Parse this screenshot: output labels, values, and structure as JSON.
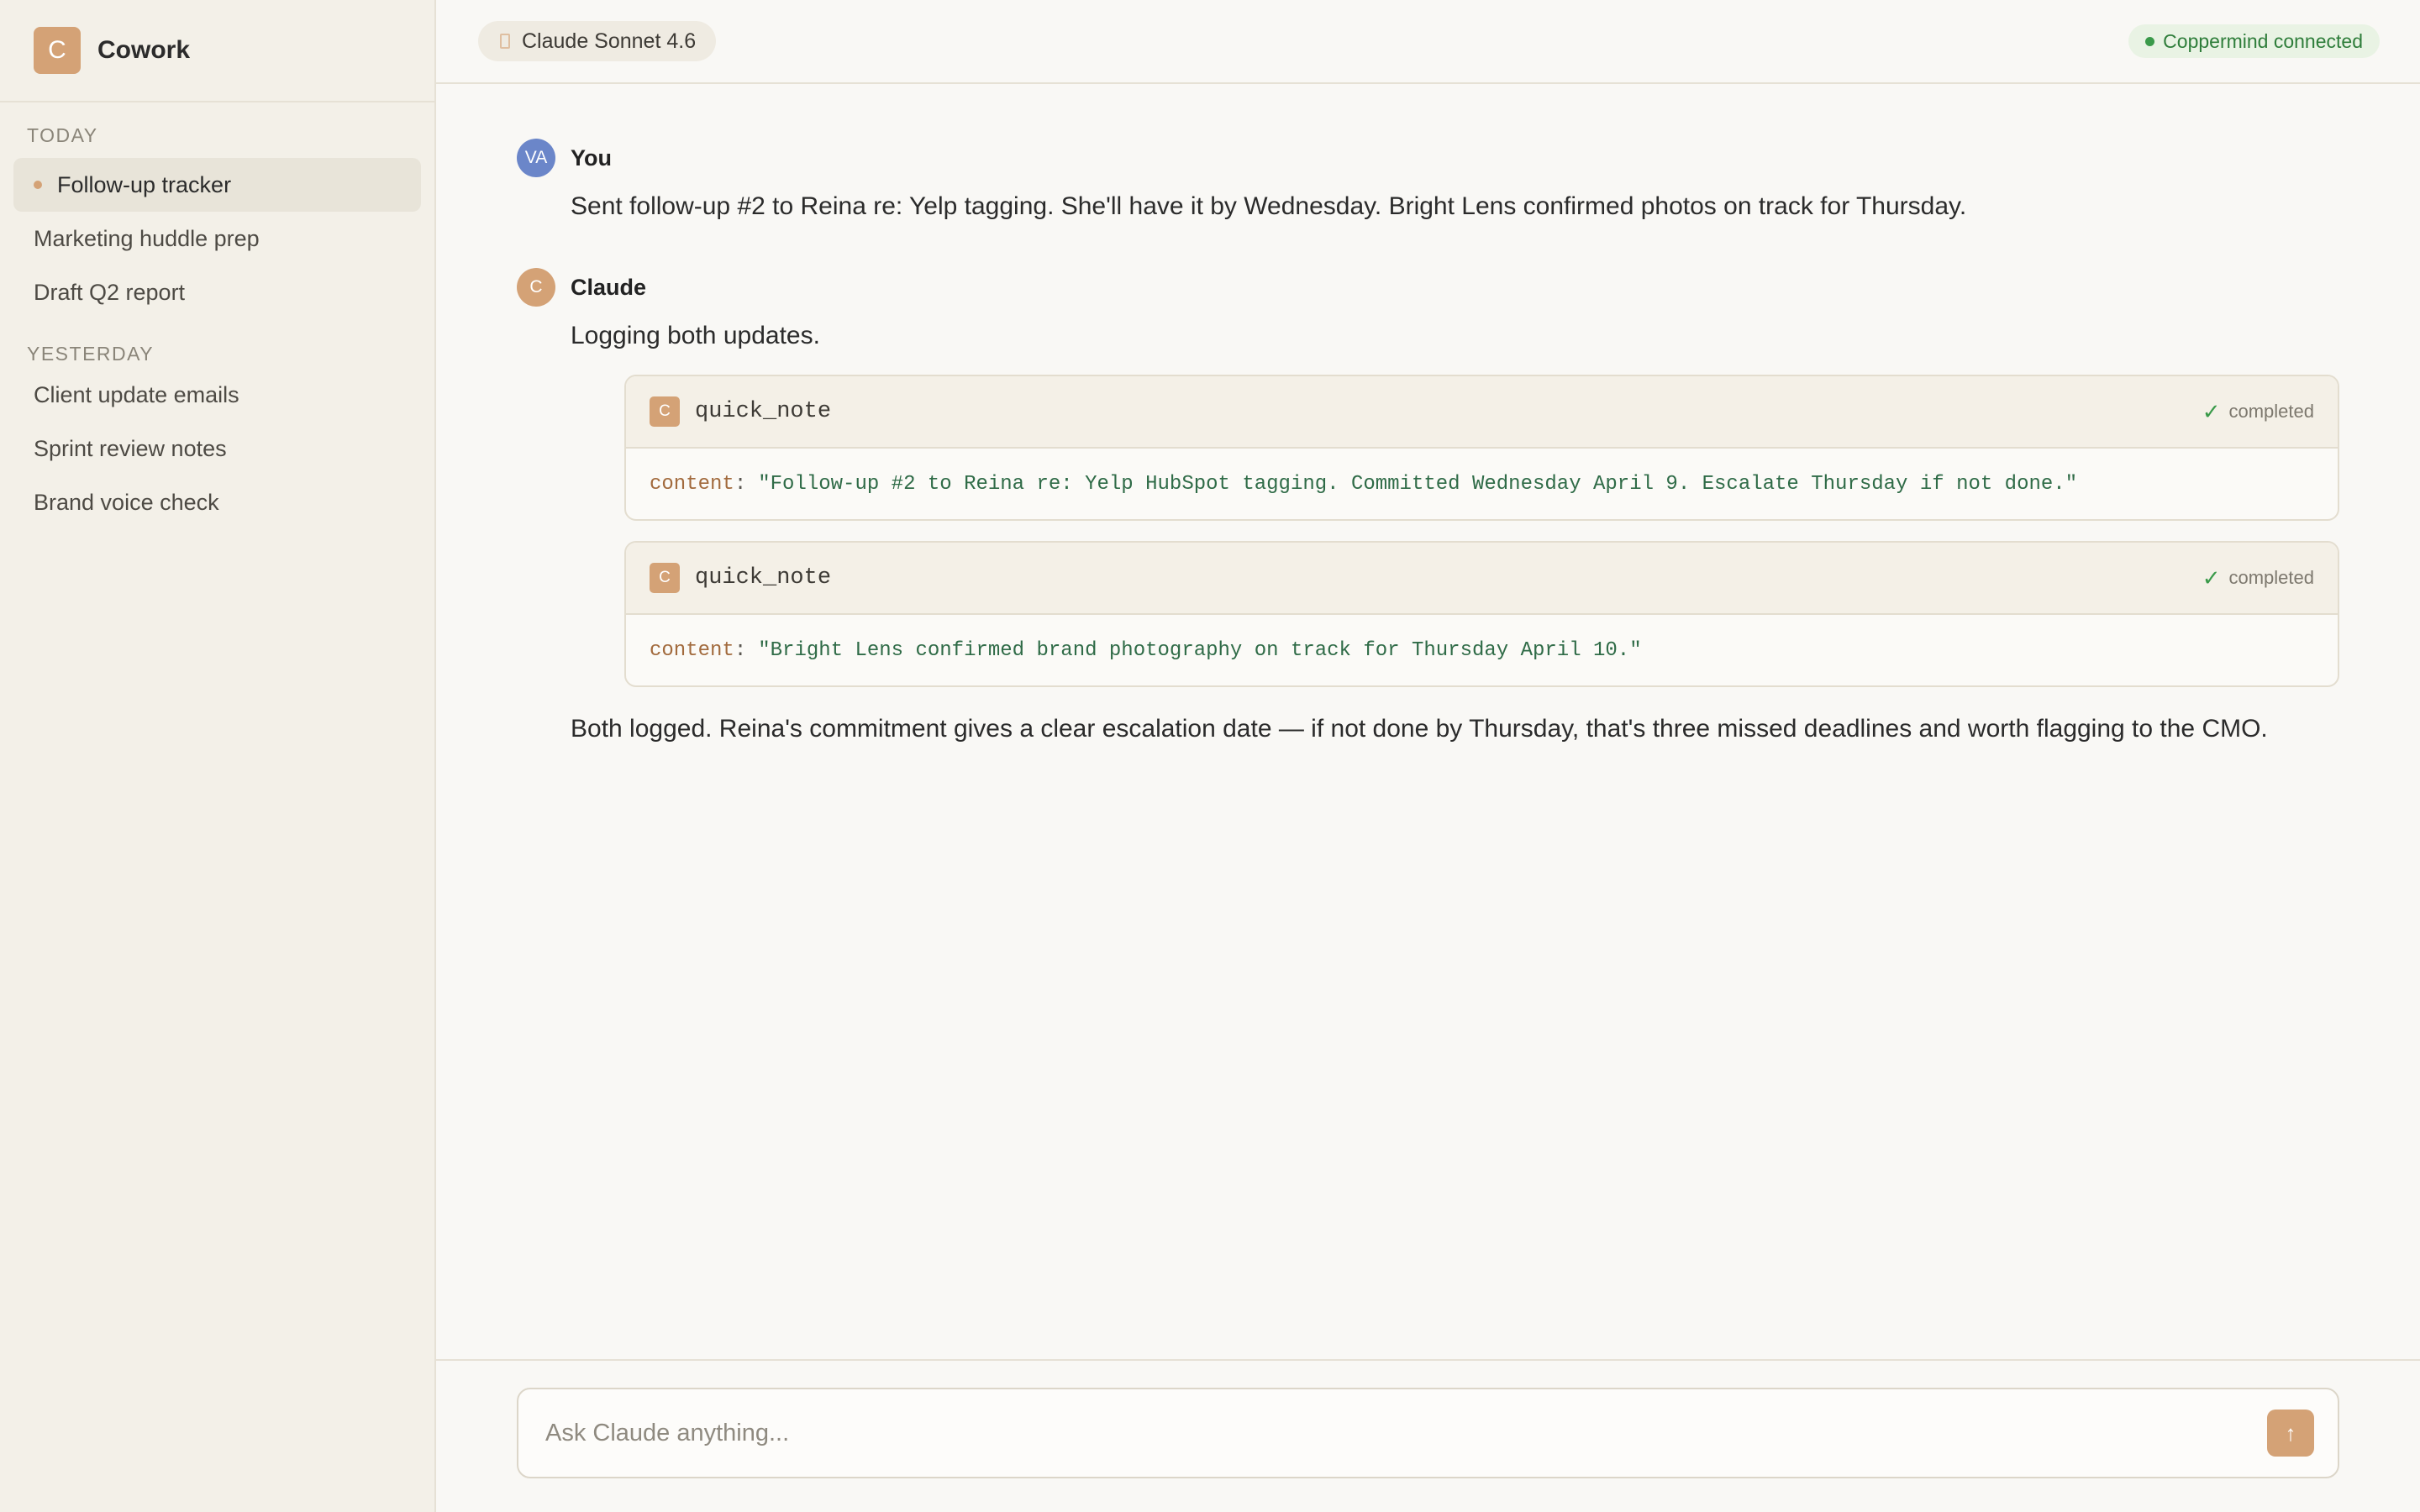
{
  "app": {
    "logo_letter": "C",
    "name": "Cowork"
  },
  "sidebar": {
    "sections": [
      {
        "label": "TODAY",
        "items": [
          {
            "label": "Follow-up tracker",
            "active": true
          },
          {
            "label": "Marketing huddle prep"
          },
          {
            "label": "Draft Q2 report"
          }
        ]
      },
      {
        "label": "YESTERDAY",
        "items": [
          {
            "label": "Client update emails"
          },
          {
            "label": "Sprint review notes"
          },
          {
            "label": "Brand voice check"
          }
        ]
      }
    ]
  },
  "header": {
    "model": "Claude Sonnet 4.6",
    "status": "Coppermind connected",
    "status_color": "#3a9a4a"
  },
  "conversation": {
    "user": {
      "initials": "VA",
      "name": "You",
      "text": "Sent follow-up #2 to Reina re: Yelp tagging. She'll have it by Wednesday. Bright Lens confirmed photos on track for Thursday."
    },
    "assistant": {
      "initials": "C",
      "name": "Claude",
      "intro": "Logging both updates.",
      "tool_calls": [
        {
          "badge": "C",
          "name": "quick_note",
          "status": "completed",
          "arg_key": "content",
          "arg_sep": ":",
          "arg_value": "\"Follow-up #2 to Reina re: Yelp HubSpot tagging. Committed Wednesday April 9. Escalate Thursday if not done.\""
        },
        {
          "badge": "C",
          "name": "quick_note",
          "status": "completed",
          "arg_key": "content",
          "arg_sep": ":",
          "arg_value": "\"Bright Lens confirmed brand photography on track for Thursday April 10.\""
        }
      ],
      "outro": "Both logged. Reina's commitment gives a clear escalation date — if not done by Thursday, that's three missed deadlines and worth flagging to the CMO."
    }
  },
  "composer": {
    "placeholder": "Ask Claude anything...",
    "send_icon": "arrow-up-icon"
  },
  "colors": {
    "accent": "#d4a276",
    "user_avatar": "#6b86c9",
    "sidebar_bg": "#f3f0e8",
    "main_bg": "#f9f8f5"
  }
}
